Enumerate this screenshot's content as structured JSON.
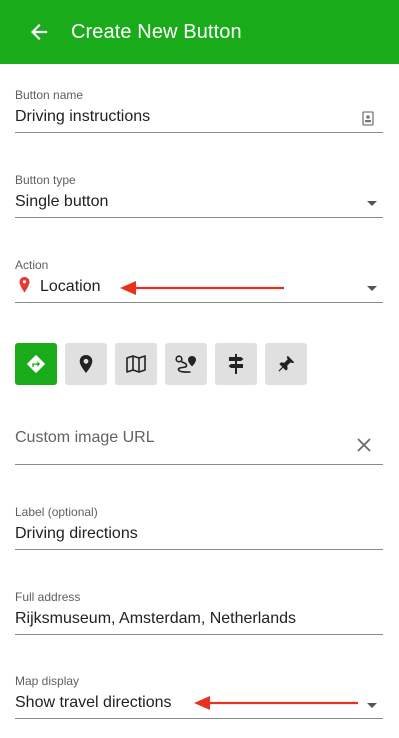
{
  "header": {
    "title": "Create New Button",
    "background": "#1aab1a"
  },
  "fields": {
    "button_name": {
      "label": "Button name",
      "value": "Driving instructions"
    },
    "button_type": {
      "label": "Button type",
      "value": "Single button"
    },
    "action": {
      "label": "Action",
      "value": "Location",
      "icon": "pin-icon"
    },
    "custom_image": {
      "placeholder": "Custom image URL"
    },
    "label": {
      "label": "Label (optional)",
      "value": "Driving directions"
    },
    "address": {
      "label": "Full address",
      "value": "Rijksmuseum, Amsterdam, Netherlands"
    },
    "map_display": {
      "label": "Map display",
      "value": "Show travel directions"
    }
  },
  "icon_options": [
    {
      "name": "directions-icon",
      "selected": true
    },
    {
      "name": "location-pin-icon",
      "selected": false
    },
    {
      "name": "map-icon",
      "selected": false
    },
    {
      "name": "route-icon",
      "selected": false
    },
    {
      "name": "signpost-icon",
      "selected": false
    },
    {
      "name": "push-pin-icon",
      "selected": false
    }
  ],
  "annotations": {
    "arrow_color": "#e8321f"
  }
}
